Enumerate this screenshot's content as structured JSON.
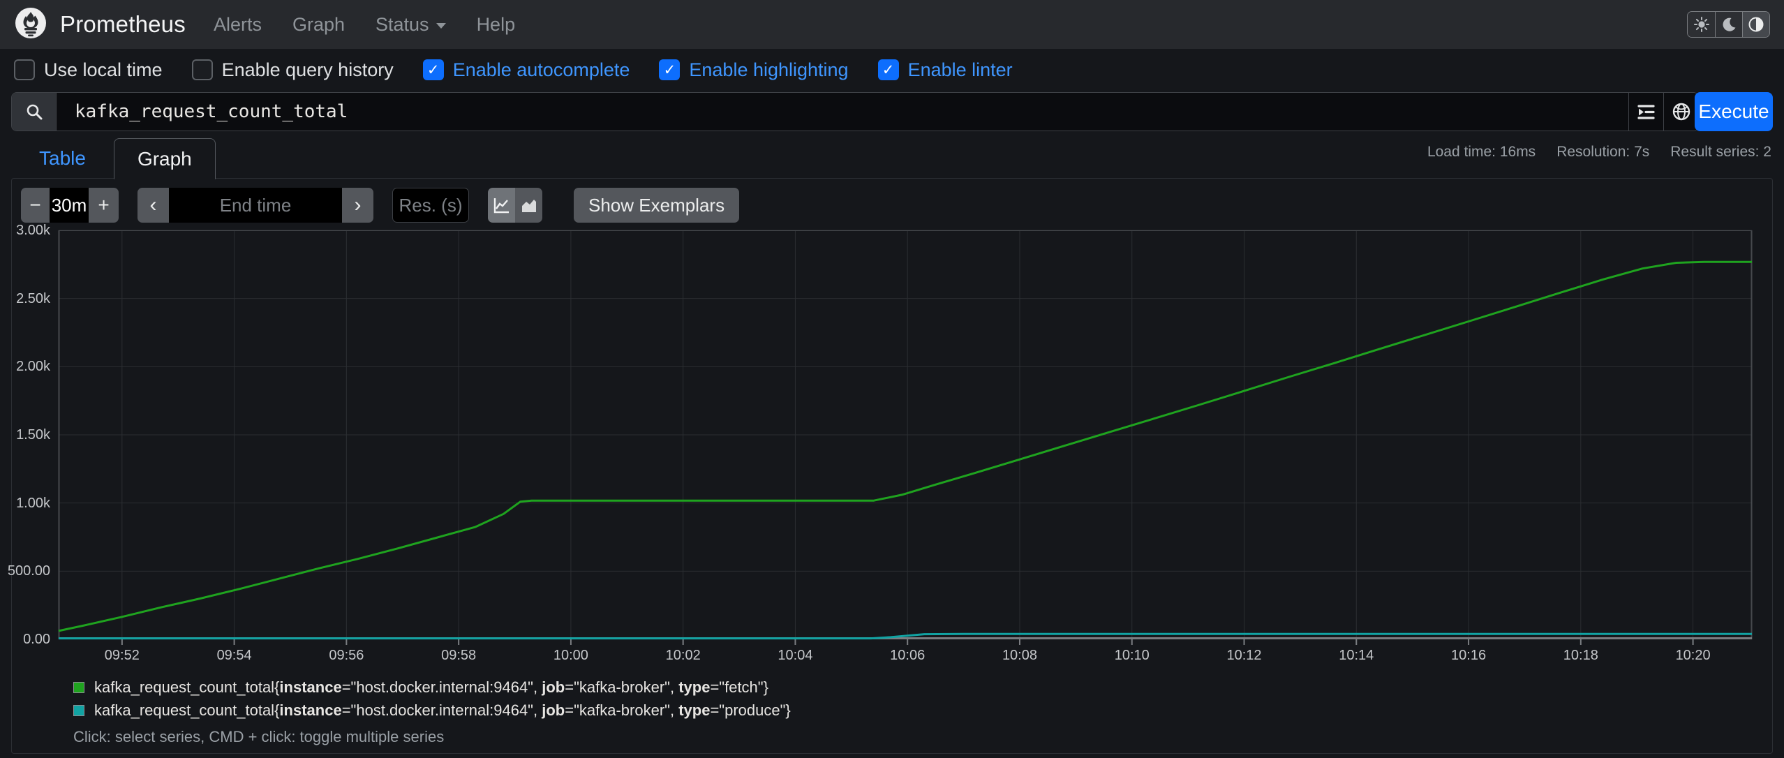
{
  "navbar": {
    "brand": "Prometheus",
    "items": [
      {
        "label": "Alerts"
      },
      {
        "label": "Graph"
      },
      {
        "label": "Status"
      },
      {
        "label": "Help"
      }
    ]
  },
  "options": [
    {
      "label": "Use local time",
      "checked": false
    },
    {
      "label": "Enable query history",
      "checked": false
    },
    {
      "label": "Enable autocomplete",
      "checked": true
    },
    {
      "label": "Enable highlighting",
      "checked": true
    },
    {
      "label": "Enable linter",
      "checked": true
    }
  ],
  "query": {
    "value": "kafka_request_count_total",
    "execute_label": "Execute"
  },
  "tabs": {
    "table": "Table",
    "graph": "Graph"
  },
  "stats": {
    "load_time": "Load time: 16ms",
    "resolution": "Resolution: 7s",
    "result_series": "Result series: 2"
  },
  "controls": {
    "range_decrement": "−",
    "range_value": "30m",
    "range_increment": "+",
    "back": "‹",
    "forward": "›",
    "end_time_placeholder": "End time",
    "res_placeholder": "Res. (s)",
    "show_exemplars": "Show Exemplars",
    "check_mark": "✓"
  },
  "chart_data": {
    "type": "line",
    "title": "",
    "xlabel": "",
    "ylabel": "",
    "grid": true,
    "legend_position": "bottom",
    "x_axis": {
      "unit": "time of day (HH:MM)",
      "origin": "09:50",
      "range_minutes": [
        0.87,
        31.05
      ],
      "tick_positions_minutes": [
        2,
        4,
        6,
        8,
        10,
        12,
        14,
        16,
        18,
        20,
        22,
        24,
        26,
        28,
        30
      ],
      "tick_labels": [
        "09:52",
        "09:54",
        "09:56",
        "09:58",
        "10:00",
        "10:02",
        "10:04",
        "10:06",
        "10:08",
        "10:10",
        "10:12",
        "10:14",
        "10:16",
        "10:18",
        "10:20"
      ]
    },
    "y_axis": {
      "range": [
        0,
        3000
      ],
      "tick_values": [
        0,
        500,
        1000,
        1500,
        2000,
        2500,
        3000
      ],
      "tick_labels": [
        "0.00",
        "500.00",
        "1.00k",
        "1.50k",
        "2.00k",
        "2.50k",
        "3.00k"
      ]
    },
    "series": [
      {
        "name": "kafka_request_count_total{instance=\"host.docker.internal:9464\", job=\"kafka-broker\", type=\"fetch\"}",
        "color": "#1fa31f",
        "points": [
          [
            0.87,
            62
          ],
          [
            1.3,
            100
          ],
          [
            2,
            165
          ],
          [
            2.7,
            235
          ],
          [
            3.4,
            300
          ],
          [
            4.1,
            370
          ],
          [
            4.8,
            445
          ],
          [
            5.5,
            520
          ],
          [
            6.2,
            590
          ],
          [
            6.9,
            665
          ],
          [
            7.6,
            745
          ],
          [
            8.3,
            825
          ],
          [
            8.8,
            920
          ],
          [
            9.1,
            1010
          ],
          [
            9.3,
            1018
          ],
          [
            15.4,
            1018
          ],
          [
            15.9,
            1060
          ],
          [
            16.5,
            1135
          ],
          [
            17.2,
            1220
          ],
          [
            18,
            1320
          ],
          [
            18.8,
            1420
          ],
          [
            19.6,
            1520
          ],
          [
            20.4,
            1620
          ],
          [
            21.2,
            1720
          ],
          [
            22,
            1822
          ],
          [
            22.8,
            1925
          ],
          [
            23.6,
            2025
          ],
          [
            24.4,
            2128
          ],
          [
            25.2,
            2230
          ],
          [
            26,
            2332
          ],
          [
            26.8,
            2435
          ],
          [
            27.6,
            2538
          ],
          [
            28.4,
            2640
          ],
          [
            29.1,
            2720
          ],
          [
            29.7,
            2762
          ],
          [
            30.2,
            2768
          ],
          [
            31.05,
            2768
          ]
        ]
      },
      {
        "name": "kafka_request_count_total{instance=\"host.docker.internal:9464\", job=\"kafka-broker\", type=\"produce\"}",
        "color": "#11a3a3",
        "points": [
          [
            0.87,
            7
          ],
          [
            15.35,
            7
          ],
          [
            15.7,
            16
          ],
          [
            16.3,
            38
          ],
          [
            17,
            40
          ],
          [
            31.05,
            40
          ]
        ]
      }
    ]
  },
  "legend": {
    "items": [
      {
        "color": "#1fa31f",
        "segments": [
          [
            "kafka_request_count_total{",
            0
          ],
          [
            "instance",
            1
          ],
          [
            "=\"host.docker.internal:9464\", ",
            0
          ],
          [
            "job",
            1
          ],
          [
            "=\"kafka-broker\", ",
            0
          ],
          [
            "type",
            1
          ],
          [
            "=\"fetch\"}",
            0
          ]
        ]
      },
      {
        "color": "#11a3a3",
        "segments": [
          [
            "kafka_request_count_total{",
            0
          ],
          [
            "instance",
            1
          ],
          [
            "=\"host.docker.internal:9464\", ",
            0
          ],
          [
            "job",
            1
          ],
          [
            "=\"kafka-broker\", ",
            0
          ],
          [
            "type",
            1
          ],
          [
            "=\"produce\"}",
            0
          ]
        ]
      }
    ],
    "hint": "Click: select series, CMD + click: toggle multiple series"
  },
  "colors": {
    "accent_blue": "#0d6efd",
    "link_blue": "#3f96ff",
    "navbar_bg": "#27292d",
    "body_bg": "#15171b",
    "grid": "#2b2e32",
    "plot_border": "#46494d",
    "axis_line": "#7a7d81",
    "series_fetch": "#1fa31f",
    "series_produce": "#11a3a3"
  }
}
